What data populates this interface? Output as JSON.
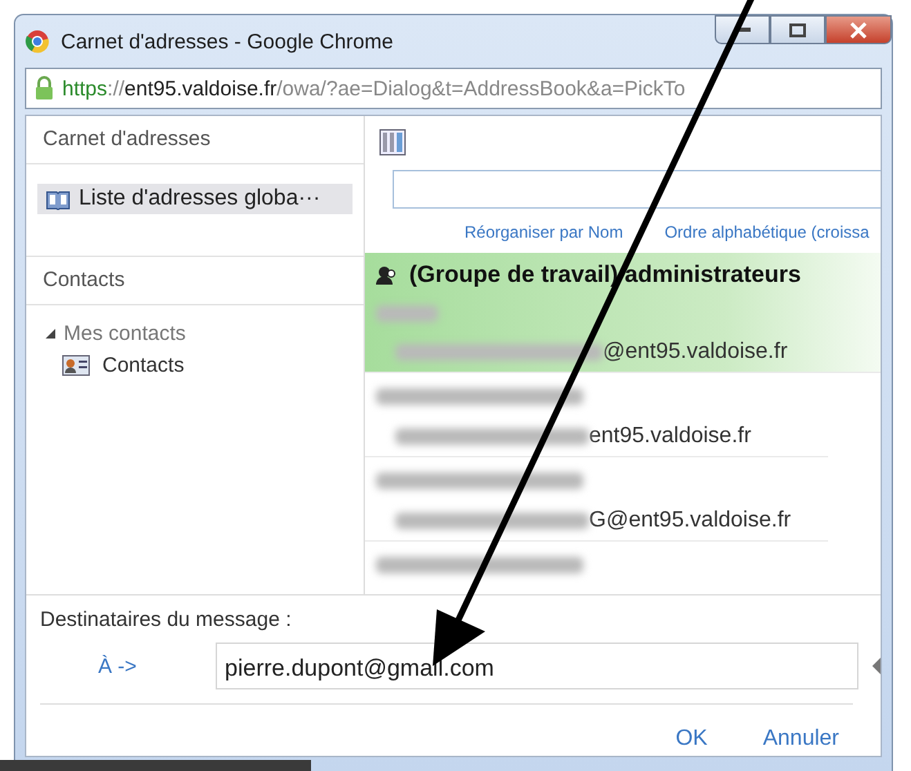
{
  "window": {
    "title": "Carnet d'adresses - Google Chrome"
  },
  "address_bar": {
    "scheme": "https",
    "separator": "://",
    "host": "ent95.valdoise.fr",
    "path": "/owa/?ae=Dialog&t=AddressBook&a=PickTo"
  },
  "sidebar": {
    "address_books_title": "Carnet d'adresses",
    "address_books": [
      {
        "label": "Liste d'adresses globa···",
        "selected": true
      }
    ],
    "contacts_title": "Contacts",
    "tree": [
      {
        "label": "Mes contacts",
        "expanded": true,
        "children": [
          {
            "label": "Contacts",
            "selected": false
          }
        ]
      }
    ]
  },
  "sort_links": [
    "Réorganiser par Nom",
    "Ordre alphabétique (croissa"
  ],
  "contacts": [
    {
      "kind": "group",
      "selected": true,
      "name": "(Groupe de travail) administrateurs",
      "email_end": "@ent95.valdoise.fr"
    },
    {
      "kind": "person",
      "selected": false,
      "email_end": "ent95.valdoise.fr"
    },
    {
      "kind": "person",
      "selected": false,
      "email_end": "G@ent95.valdoise.fr"
    },
    {
      "kind": "person",
      "selected": false
    }
  ],
  "recipients": {
    "title": "Destinataires du message :",
    "to_label": "À ->",
    "to_value": "pierre.dupont@gmail.com"
  },
  "buttons": [
    "OK",
    "Annuler"
  ]
}
